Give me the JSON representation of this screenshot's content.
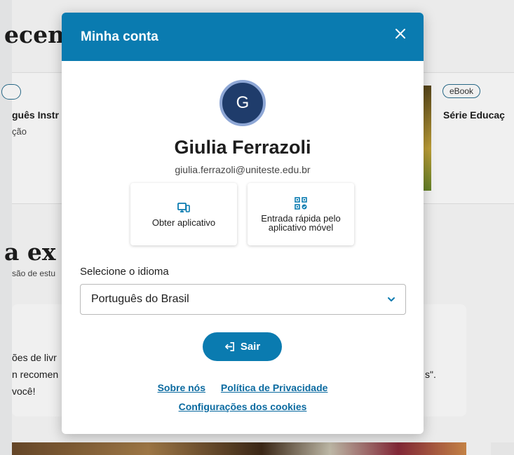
{
  "background": {
    "heading_top": "ecen",
    "heading_mid": "a ex",
    "left_pill": "",
    "right_pill": "eBook",
    "left_book_title": "guês Instr",
    "left_book_sub": "ção",
    "right_book_title": "Série Educaç",
    "mid_sub": "são de estu",
    "info_line1": "ões de livr",
    "info_line2": "n recomen",
    "info_line3": "você!",
    "info_right": "s\"."
  },
  "modal": {
    "title": "Minha conta",
    "close_icon": "close-icon",
    "user": {
      "initial": "G",
      "name": "Giulia Ferrazoli",
      "email": "giulia.ferrazoli@uniteste.edu.br"
    },
    "actions": [
      {
        "label": "Obter aplicativo",
        "icon": "devices-icon"
      },
      {
        "label": "Entrada rápida pelo aplicativo móvel",
        "icon": "qr-code-icon"
      }
    ],
    "language": {
      "label": "Selecione o idioma",
      "value": "Português do Brasil"
    },
    "logout_label": "Sair",
    "links": {
      "about": "Sobre nós",
      "privacy": "Política de Privacidade",
      "cookies": "Configurações dos cookies"
    }
  },
  "colors": {
    "primary": "#0a7bb0",
    "avatar_bg": "#1f3c6b",
    "avatar_ring": "#8ea7d6"
  }
}
